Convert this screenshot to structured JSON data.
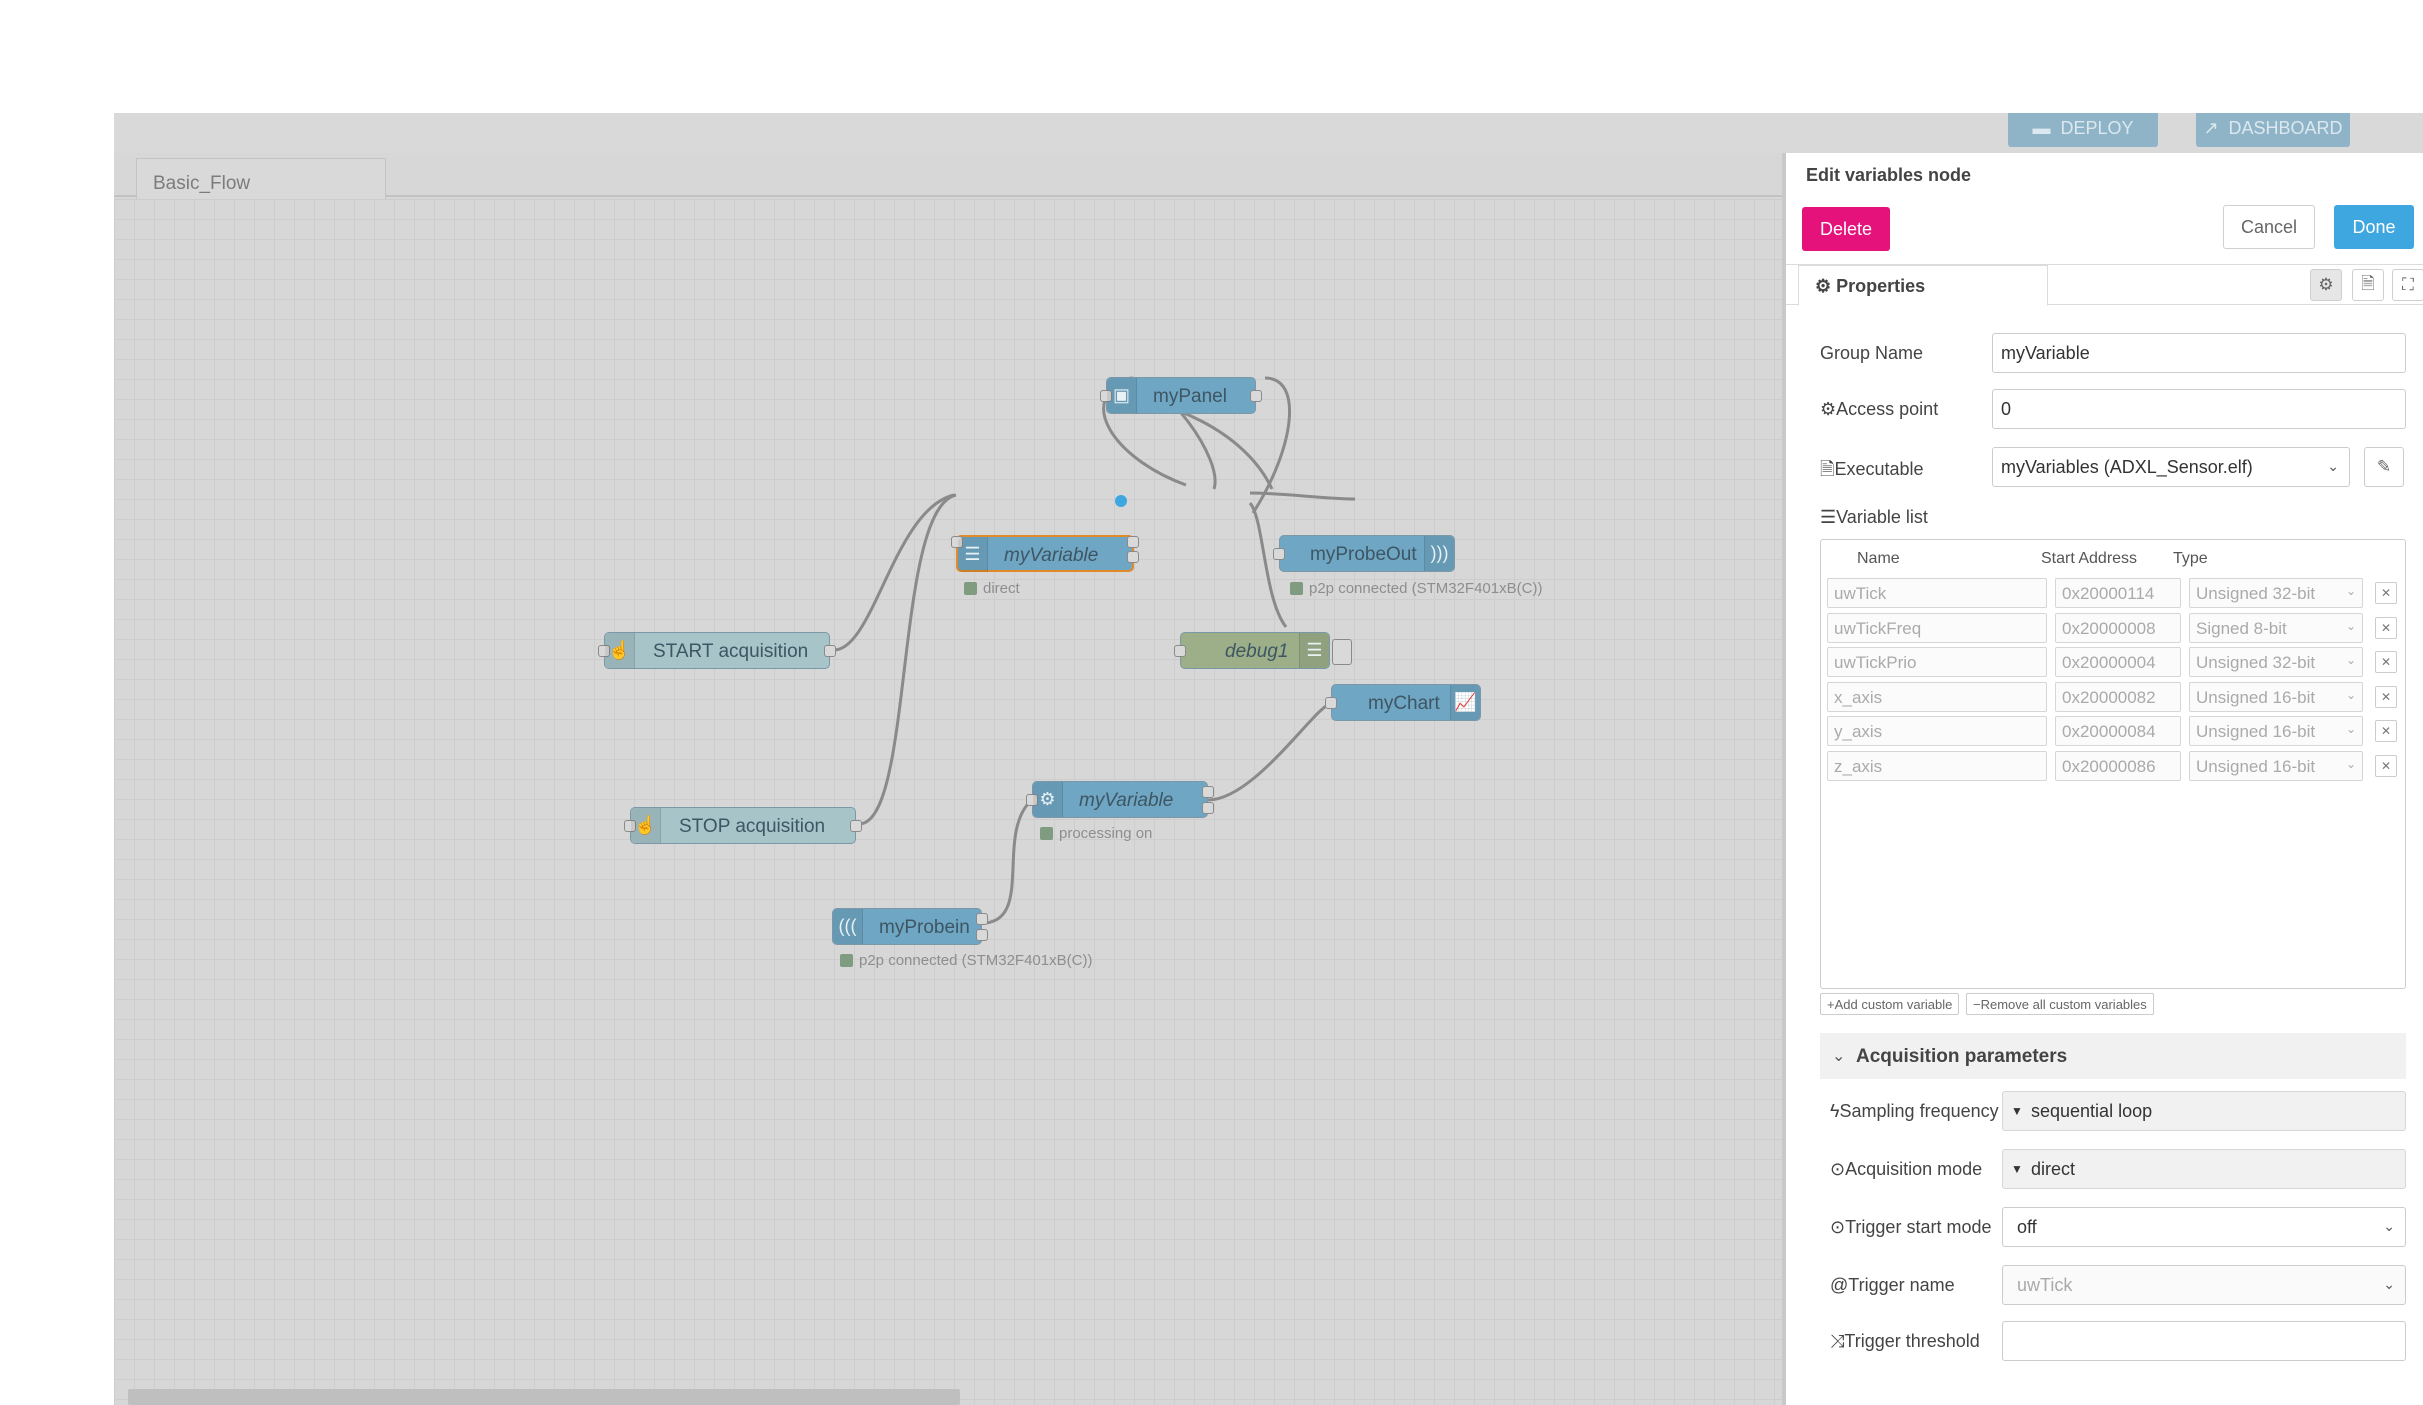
{
  "header": {
    "deploy_label": "DEPLOY",
    "dashboard_label": "DASHBOARD"
  },
  "workspace": {
    "tab_label": "Basic_Flow",
    "nodes": {
      "myPanel": "myPanel",
      "myVariable_top": "myVariable",
      "myVariable_top_status": "direct",
      "myProbeOut": "myProbeOut",
      "myProbeOut_status": "p2p connected (STM32F401xB(C))",
      "debug1": "debug1",
      "start": "START acquisition",
      "stop": "STOP acquisition",
      "myChart": "myChart",
      "myVariable_proc": "myVariable",
      "myVariable_proc_status": "processing on",
      "myProbeIn": "myProbein",
      "myProbeIn_status": "p2p connected (STM32F401xB(C))"
    }
  },
  "editor": {
    "title": "Edit variables node",
    "delete_label": "Delete",
    "cancel_label": "Cancel",
    "done_label": "Done",
    "properties_tab": "Properties",
    "group_name_label": "Group Name",
    "group_name_value": "myVariable",
    "access_point_label": "Access point",
    "access_point_value": "0",
    "executable_label": "Executable",
    "executable_value": "myVariables (ADXL_Sensor.elf)",
    "variable_list_label": "Variable list",
    "columns": {
      "name": "Name",
      "address": "Start Address",
      "type": "Type"
    },
    "variables": [
      {
        "name": "uwTick",
        "address": "0x20000114",
        "type": "Unsigned 32-bit"
      },
      {
        "name": "uwTickFreq",
        "address": "0x20000008",
        "type": "Signed 8-bit"
      },
      {
        "name": "uwTickPrio",
        "address": "0x20000004",
        "type": "Unsigned 32-bit"
      },
      {
        "name": "x_axis",
        "address": "0x20000082",
        "type": "Unsigned 16-bit"
      },
      {
        "name": "y_axis",
        "address": "0x20000084",
        "type": "Unsigned 16-bit"
      },
      {
        "name": "z_axis",
        "address": "0x20000086",
        "type": "Unsigned 16-bit"
      }
    ],
    "add_custom_label": "Add custom variable",
    "remove_all_label": "Remove all custom variables",
    "acq_section_label": "Acquisition parameters",
    "sampling_label": "Sampling frequency",
    "sampling_value": "sequential loop",
    "acq_mode_label": "Acquisition mode",
    "acq_mode_value": "direct",
    "trigger_start_label": "Trigger start mode",
    "trigger_start_value": "off",
    "trigger_name_label": "Trigger name",
    "trigger_name_value": "uwTick",
    "trigger_threshold_label": "Trigger threshold",
    "trigger_threshold_value": ""
  }
}
